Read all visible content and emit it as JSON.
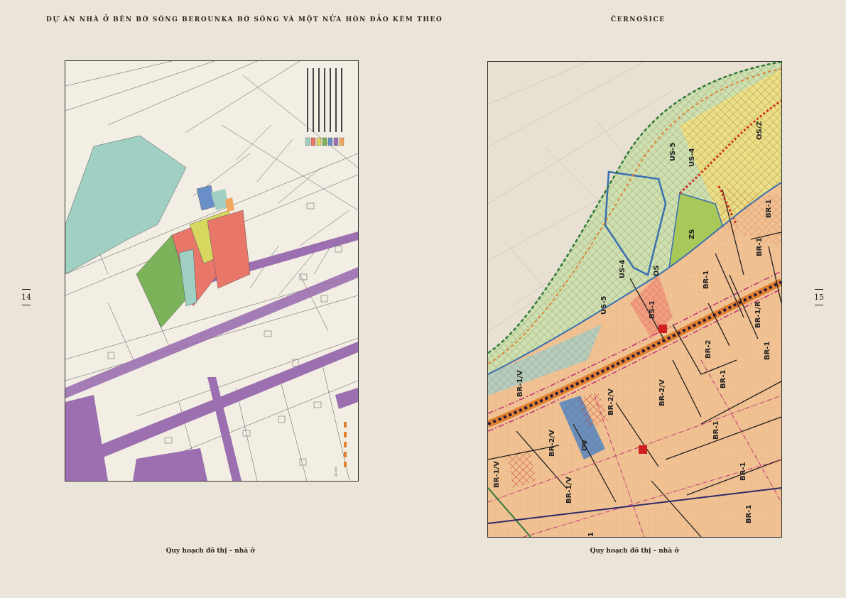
{
  "header": {
    "left_title": "DỰ ÁN NHÀ Ở BÊN BỜ SÔNG BEROUNKA BỜ SÔNG VÀ MỘT NỬA HÒN ĐẢO KÈM THEO",
    "right_title": "ČERNOŠICE"
  },
  "pages": {
    "left_number": "14",
    "right_number": "15"
  },
  "captions": {
    "left": "Quy hoạch đô thị – nhà ở",
    "right": "Quy hoạch đô thị – nhà ở"
  },
  "left_map": {
    "scale_label": "1:1 000",
    "legend_colors": [
      "#9fd0c3",
      "#e8776a",
      "#d8d860",
      "#7cb35a",
      "#6a8fc8",
      "#9b6fb0",
      "#f0a860"
    ]
  },
  "right_map": {
    "zone_labels": [
      "US-5",
      "US-4",
      "OS/Z",
      "ZS",
      "US-4",
      "OS",
      "US-5",
      "BS-1",
      "BR-1",
      "BR-1/R",
      "BR-2",
      "BR-1",
      "BR-1",
      "BR-1/V",
      "BR-2/V",
      "BR-2/V",
      "BR-1",
      "OV",
      "BR-2/V",
      "BR-1/V",
      "BR-1/V",
      "BR-1",
      "BR-1",
      "BR-1",
      "BR-1",
      "1"
    ]
  }
}
